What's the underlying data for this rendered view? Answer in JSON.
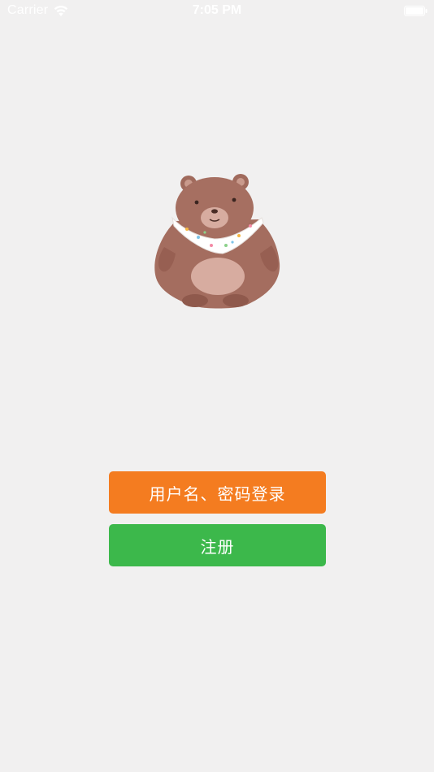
{
  "status_bar": {
    "carrier": "Carrier",
    "time": "7:05 PM",
    "icons": [
      "wifi-icon",
      "battery-icon"
    ]
  },
  "mascot": {
    "icon": "bear-mascot-icon"
  },
  "actions": {
    "login_label": "用户名、密码登录",
    "register_label": "注册"
  },
  "colors": {
    "background": "#f1f0f0",
    "login_button": "#f47c20",
    "register_button": "#3cb84b",
    "status_text": "#ffffff"
  }
}
